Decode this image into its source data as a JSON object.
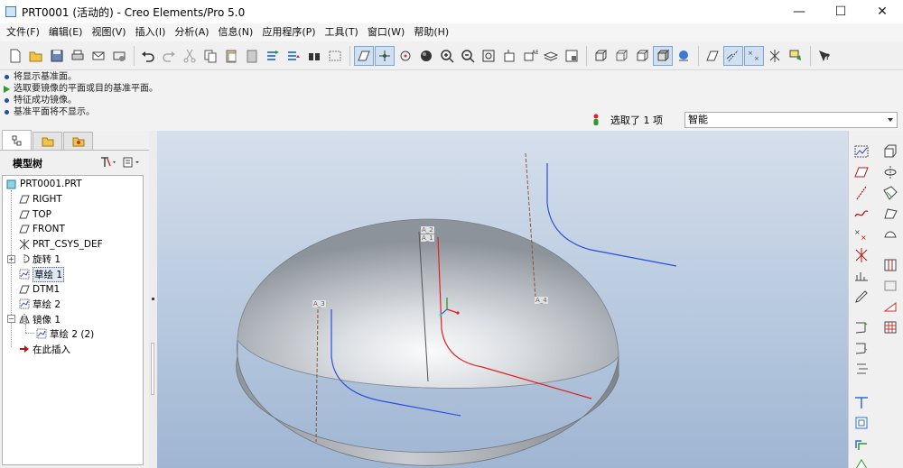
{
  "window": {
    "title": "PRT0001 (活动的) - Creo Elements/Pro 5.0",
    "minimize": "—",
    "maximize": "☐",
    "close": "✕"
  },
  "menu": {
    "items": [
      "文件(F)",
      "编辑(E)",
      "视图(V)",
      "插入(I)",
      "分析(A)",
      "信息(N)",
      "应用程序(P)",
      "工具(T)",
      "窗口(W)",
      "帮助(H)"
    ]
  },
  "messages": {
    "lines": [
      {
        "text": "将显示基准面。",
        "kind": "info"
      },
      {
        "text": "选取要镜像的平面或目的基准平面。",
        "kind": "prompt"
      },
      {
        "text": "特征成功镜像。",
        "kind": "info"
      },
      {
        "text": "基准平面将不显示。",
        "kind": "info"
      }
    ]
  },
  "selection": {
    "status": "选取了 1 项",
    "filter_value": "智能"
  },
  "model_tree": {
    "title": "模型树",
    "root": "PRT0001.PRT",
    "items": [
      {
        "label": "RIGHT",
        "icon": "datum-plane-icon"
      },
      {
        "label": "TOP",
        "icon": "datum-plane-icon"
      },
      {
        "label": "FRONT",
        "icon": "datum-plane-icon"
      },
      {
        "label": "PRT_CSYS_DEF",
        "icon": "csys-icon"
      },
      {
        "label": "旋转 1",
        "icon": "revolve-icon"
      },
      {
        "label": "草绘 1",
        "icon": "sketch-icon"
      },
      {
        "label": "DTM1",
        "icon": "datum-plane-icon"
      },
      {
        "label": "草绘 2",
        "icon": "sketch-icon"
      },
      {
        "label": "镜像 1",
        "icon": "mirror-icon"
      },
      {
        "label": "草绘 2 (2)",
        "icon": "sketch-icon"
      },
      {
        "label": "在此插入",
        "icon": "insert-here-arrow-icon"
      }
    ]
  },
  "viewport": {
    "datum_labels": [
      "A_2",
      "A_1",
      "A_3",
      "A_4"
    ]
  },
  "colors": {
    "sketch_blue": "#2a4fd8",
    "sketch_red": "#e02020",
    "axis_brown": "#8a5a3a",
    "dome_light": "#f4f5f7",
    "dome_dark": "#7f858c"
  }
}
